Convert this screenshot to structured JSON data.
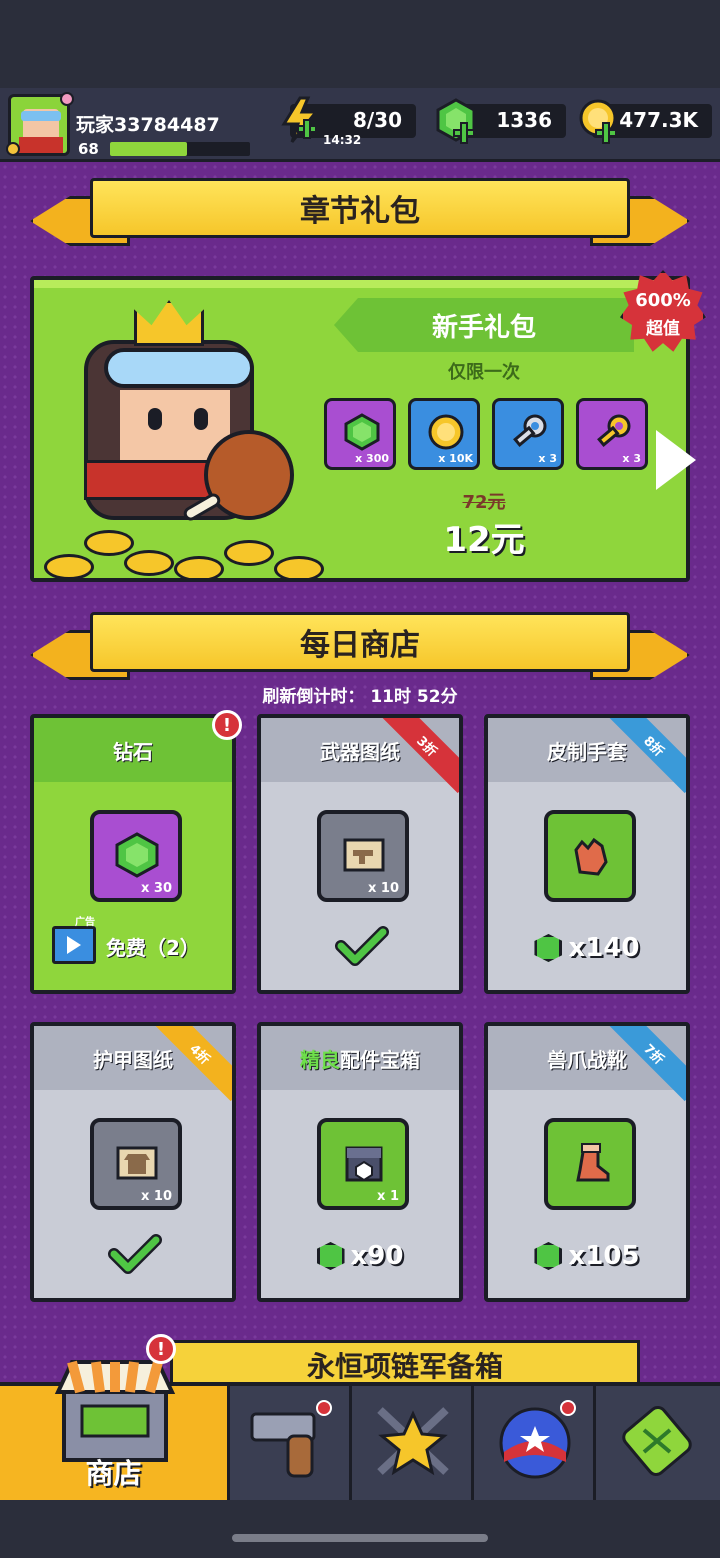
{
  "player": {
    "name": "玩家33784487",
    "level": "68",
    "xp_fraction": 0.55
  },
  "resources": {
    "energy": "8/30",
    "energy_timer": "14:32",
    "gems": "1336",
    "coins": "477.3K"
  },
  "chapter_section": {
    "title": "章节礼包",
    "gift": {
      "name": "新手礼包",
      "limit": "仅限一次",
      "value_badge_line1": "600%",
      "value_badge_line2": "超值",
      "items": [
        {
          "icon": "gem-icon",
          "qty": "x 300",
          "color": "#a94ed1"
        },
        {
          "icon": "coin-icon",
          "qty": "x 10K",
          "color": "#3a8ee0"
        },
        {
          "icon": "silver-key-icon",
          "qty": "x 3",
          "color": "#3a8ee0"
        },
        {
          "icon": "gold-key-icon",
          "qty": "x 3",
          "color": "#a94ed1"
        }
      ],
      "old_price": "72元",
      "price": "12元"
    }
  },
  "daily_shop": {
    "title": "每日商店",
    "refresh_label": "刷新倒计时： 11时 52分",
    "items": [
      {
        "name": "钻石",
        "qty": "x 30",
        "action": "免费（2）",
        "ad_label": "广告",
        "discount": "",
        "alert": "!"
      },
      {
        "name": "武器图纸",
        "qty": "x 10",
        "purchased": true,
        "discount": "3折"
      },
      {
        "name": "皮制手套",
        "price": "x140",
        "discount": "8折"
      },
      {
        "name": "护甲图纸",
        "qty": "x 10",
        "purchased": true,
        "discount": "4折"
      },
      {
        "name_highlight": "精良",
        "name_rest": "配件宝箱",
        "qty": "x 1",
        "price": "x90",
        "discount": ""
      },
      {
        "name": "兽爪战靴",
        "price": "x105",
        "discount": "7折"
      }
    ]
  },
  "next_banner": {
    "title": "永恒项链军备箱"
  },
  "navbar": {
    "items": [
      {
        "label": "商店",
        "icon": "shop-icon",
        "active": true,
        "alert": "!"
      },
      {
        "label": "",
        "icon": "weapon-icon"
      },
      {
        "label": "",
        "icon": "battle-icon"
      },
      {
        "label": "",
        "icon": "talent-icon"
      },
      {
        "label": "",
        "icon": "evolve-icon"
      }
    ]
  },
  "colors": {
    "accent": "#8fd63c",
    "banner": "#f6c62a",
    "background": "#6a2a8c"
  }
}
